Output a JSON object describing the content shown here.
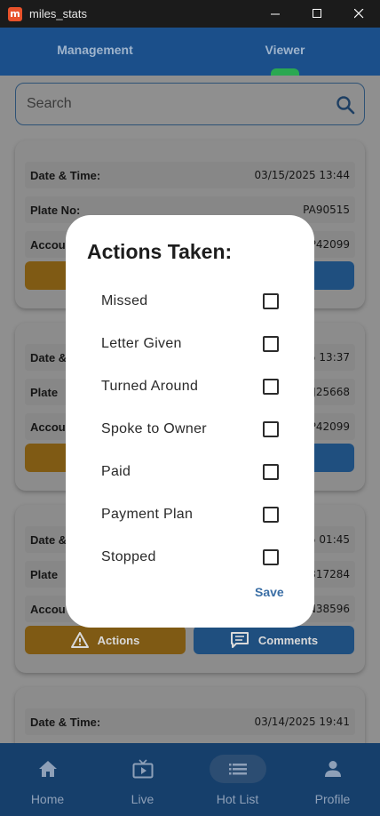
{
  "window": {
    "title": "miles_stats",
    "app_icon_letter": "m"
  },
  "tabs": [
    {
      "label": "Management",
      "active": false
    },
    {
      "label": "Viewer",
      "active": true
    }
  ],
  "search": {
    "placeholder": "Search"
  },
  "cards": [
    {
      "rows": [
        {
          "label": "Date & Time:",
          "value": "03/15/2025 13:44"
        },
        {
          "label": "Plate No:",
          "value": "PA90515"
        },
        {
          "label": "Accou",
          "value": "P42099"
        }
      ]
    },
    {
      "rows": [
        {
          "label": "Date &",
          "value": "5 13:37"
        },
        {
          "label": "Plate",
          "value": "J25668"
        },
        {
          "label": "Accou",
          "value": "P42099"
        }
      ]
    },
    {
      "rows": [
        {
          "label": "Date &",
          "value": "5 01:45"
        },
        {
          "label": "Plate",
          "value": "317284"
        },
        {
          "label": "Accou",
          "value": "N38596"
        }
      ],
      "actions_label": "Actions",
      "comments_label": "Comments"
    },
    {
      "rows": [
        {
          "label": "Date & Time:",
          "value": "03/14/2025 19:41"
        }
      ]
    }
  ],
  "dialog": {
    "title": "Actions Taken:",
    "options": [
      {
        "label": "Missed",
        "checked": false
      },
      {
        "label": "Letter Given",
        "checked": false
      },
      {
        "label": "Turned Around",
        "checked": false
      },
      {
        "label": "Spoke to Owner",
        "checked": false
      },
      {
        "label": "Paid",
        "checked": false
      },
      {
        "label": "Payment Plan",
        "checked": false
      },
      {
        "label": "Stopped",
        "checked": false
      }
    ],
    "save_label": "Save"
  },
  "bottom_nav": [
    {
      "label": "Home",
      "icon": "home-icon",
      "active": false
    },
    {
      "label": "Live",
      "icon": "live-tv-icon",
      "active": false
    },
    {
      "label": "Hot List",
      "icon": "list-icon",
      "active": true
    },
    {
      "label": "Profile",
      "icon": "person-icon",
      "active": false
    }
  ],
  "colors": {
    "brand_blue": "#1b4f8a",
    "tab_indicator": "#2aa851",
    "actions_orange": "#d08a1e",
    "comments_blue": "#2f80d0",
    "save_blue": "#3a6ea5"
  }
}
